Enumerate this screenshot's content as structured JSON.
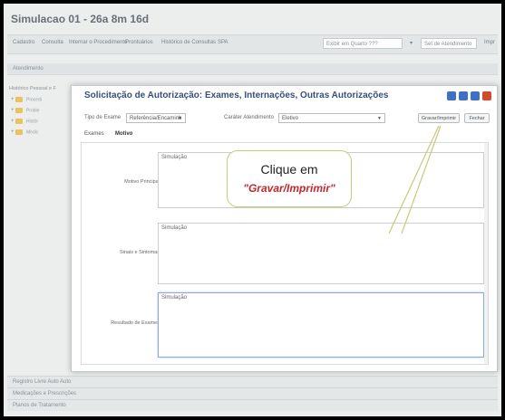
{
  "app": {
    "title": "Simulacao 01 - 26a 8m 16d"
  },
  "toolbar": {
    "items": [
      "Cadastro",
      "Consulta",
      "Internar o Procedimento",
      "Prontuários",
      "Histórico de Consultas",
      "SPA"
    ],
    "select_1": "Exibir em Quarto ???",
    "select_2": "Set de Atendimento",
    "last_item": "Impr"
  },
  "section": {
    "atendimento": "Atendimento"
  },
  "left_panel": {
    "header": "Histórico Pessoal e F",
    "items": [
      "Procedi",
      "Proble",
      "Histór",
      "Medic"
    ]
  },
  "modal": {
    "title": "Solicitação de Autorização: Exames, Internações, Outras Autorizações",
    "tipo_exame_label": "Tipo de Exame",
    "tipo_exame_value": "Referência/Encaminh",
    "caracter_label": "Caráter Atendimento",
    "caracter_value": "Eletivo",
    "gravar_button": "Gravar/Imprimir",
    "fechar_button": "Fechar",
    "tabs": [
      "Exames",
      "Motivo"
    ],
    "fields": [
      {
        "label": "Motivo Principal",
        "value": "Simulação"
      },
      {
        "label": "Sinais e Sintomas",
        "value": "Simulação"
      },
      {
        "label": "Resultado de Exames",
        "value": "Simulação"
      }
    ],
    "win_colors": [
      "#3f6fc9",
      "#3f6fc9",
      "#3f6fc9",
      "#d9472b"
    ]
  },
  "callout": {
    "line1": "Clique em",
    "line2": "\"Gravar/Imprimir\""
  },
  "bottom": [
    "Registro Livre Auto Auto",
    "Medicações e Prescrições",
    "Planos de Tratamento"
  ]
}
